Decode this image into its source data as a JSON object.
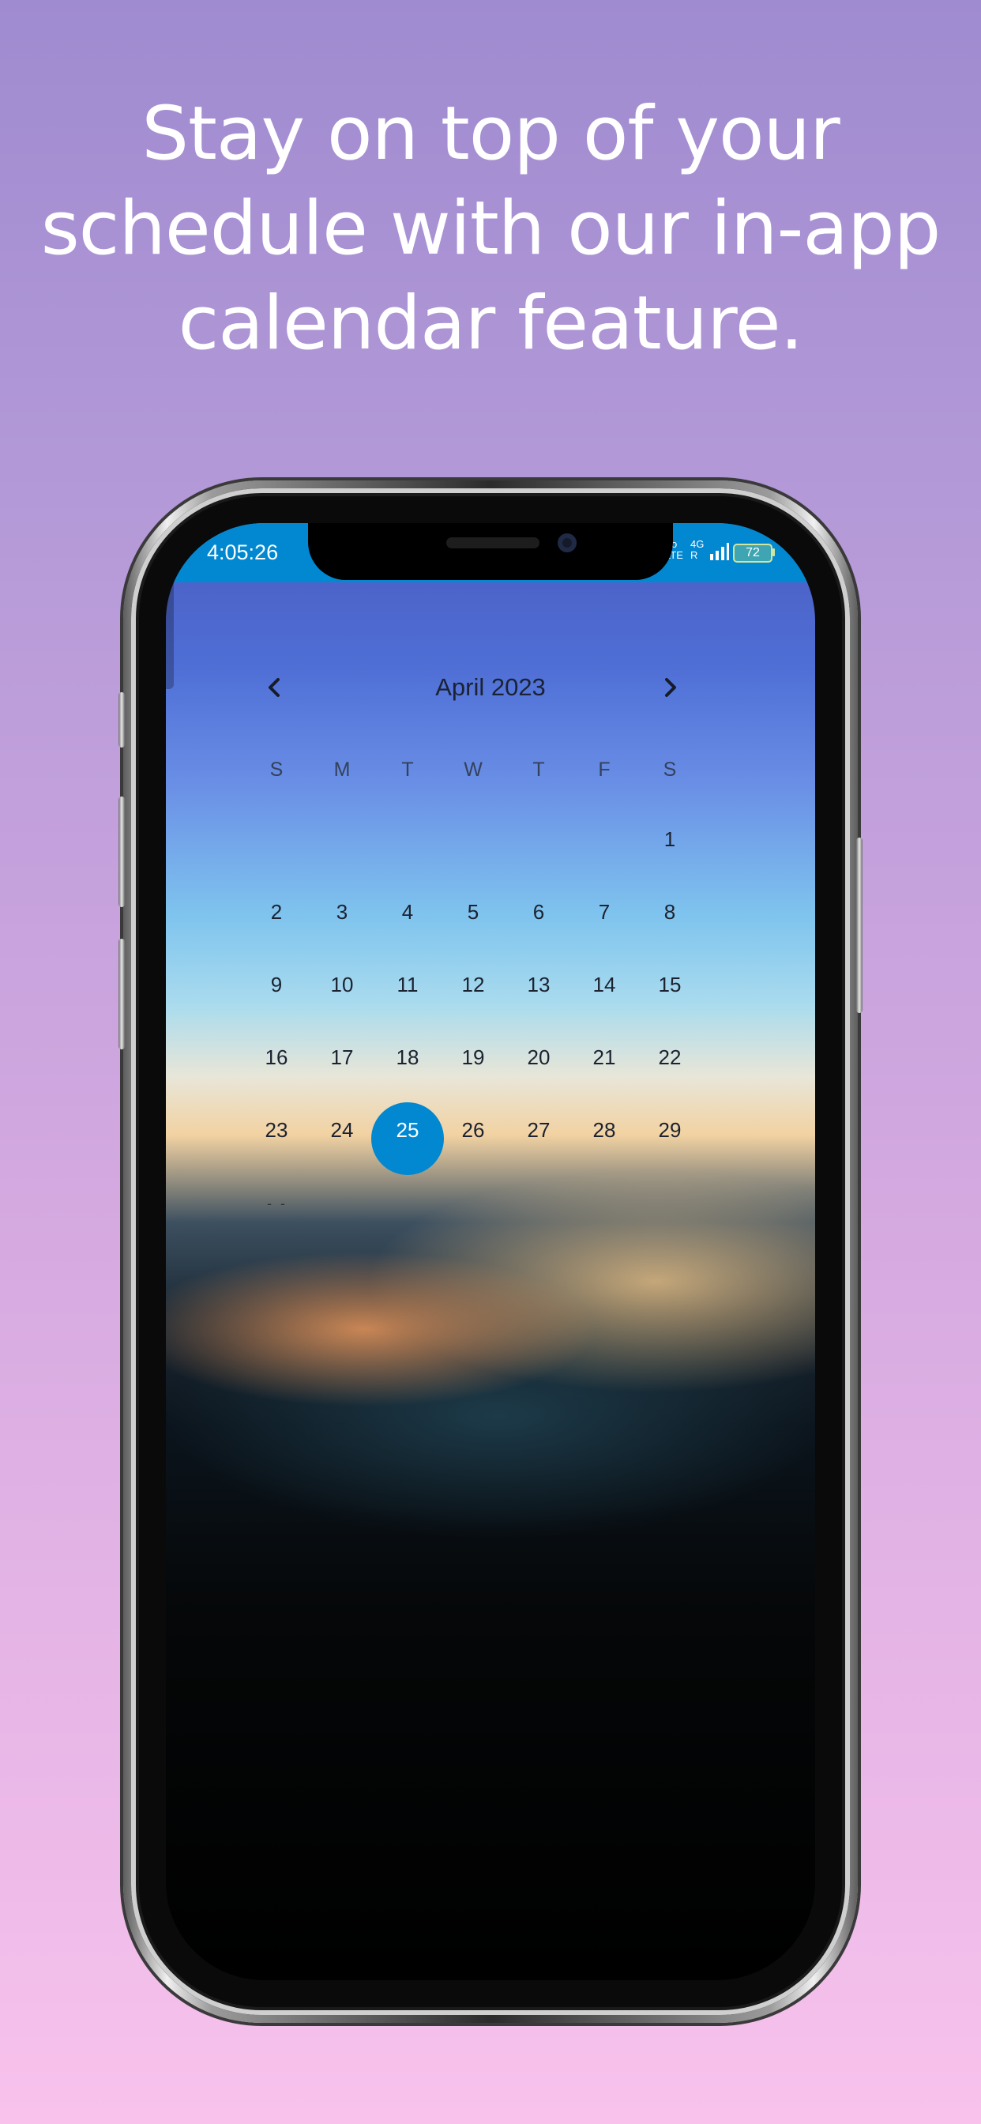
{
  "headline": {
    "line1": "Stay on top of your",
    "line2": "schedule with our in-app",
    "line3": "calendar feature."
  },
  "status_bar": {
    "time": "4:05:26",
    "network_1": "Vo LTE",
    "network_2": "4G R",
    "battery": "72"
  },
  "calendar": {
    "month_label": "April 2023",
    "weekdays": [
      "S",
      "M",
      "T",
      "W",
      "T",
      "F",
      "S"
    ],
    "weeks": [
      [
        "",
        "",
        "",
        "",
        "",
        "",
        "1"
      ],
      [
        "2",
        "3",
        "4",
        "5",
        "6",
        "7",
        "8"
      ],
      [
        "9",
        "10",
        "11",
        "12",
        "13",
        "14",
        "15"
      ],
      [
        "16",
        "17",
        "18",
        "19",
        "20",
        "21",
        "22"
      ],
      [
        "23",
        "24",
        "25",
        "26",
        "27",
        "28",
        "29"
      ]
    ],
    "selected_day": "25",
    "overflow_marker": "- -",
    "accent_color": "#0288d1"
  }
}
